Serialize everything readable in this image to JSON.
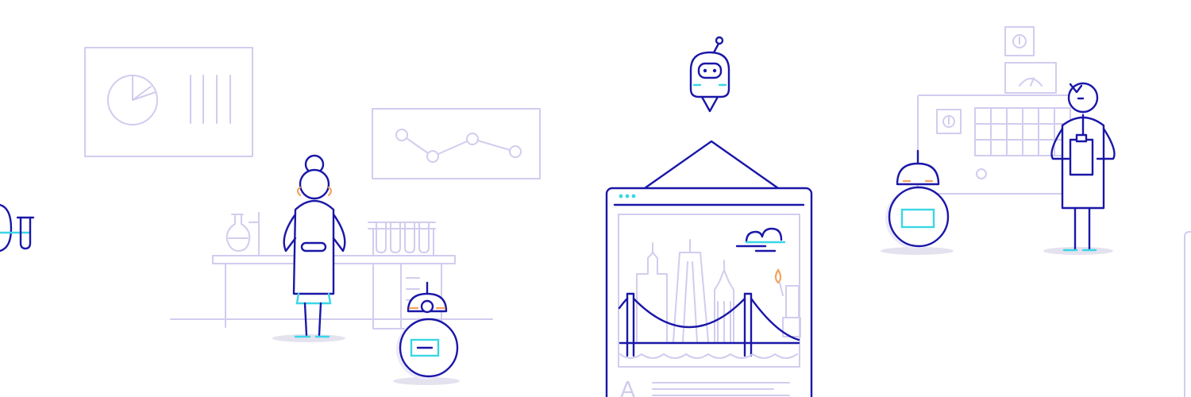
{
  "colors": {
    "primary_ink": "#1a17a8",
    "lilac_line": "#d2ccef",
    "cyan_accent": "#3ad6e6",
    "orange_accent": "#f4a25e",
    "background": "#ffffff"
  },
  "poster": {
    "caption_initial": "A"
  }
}
